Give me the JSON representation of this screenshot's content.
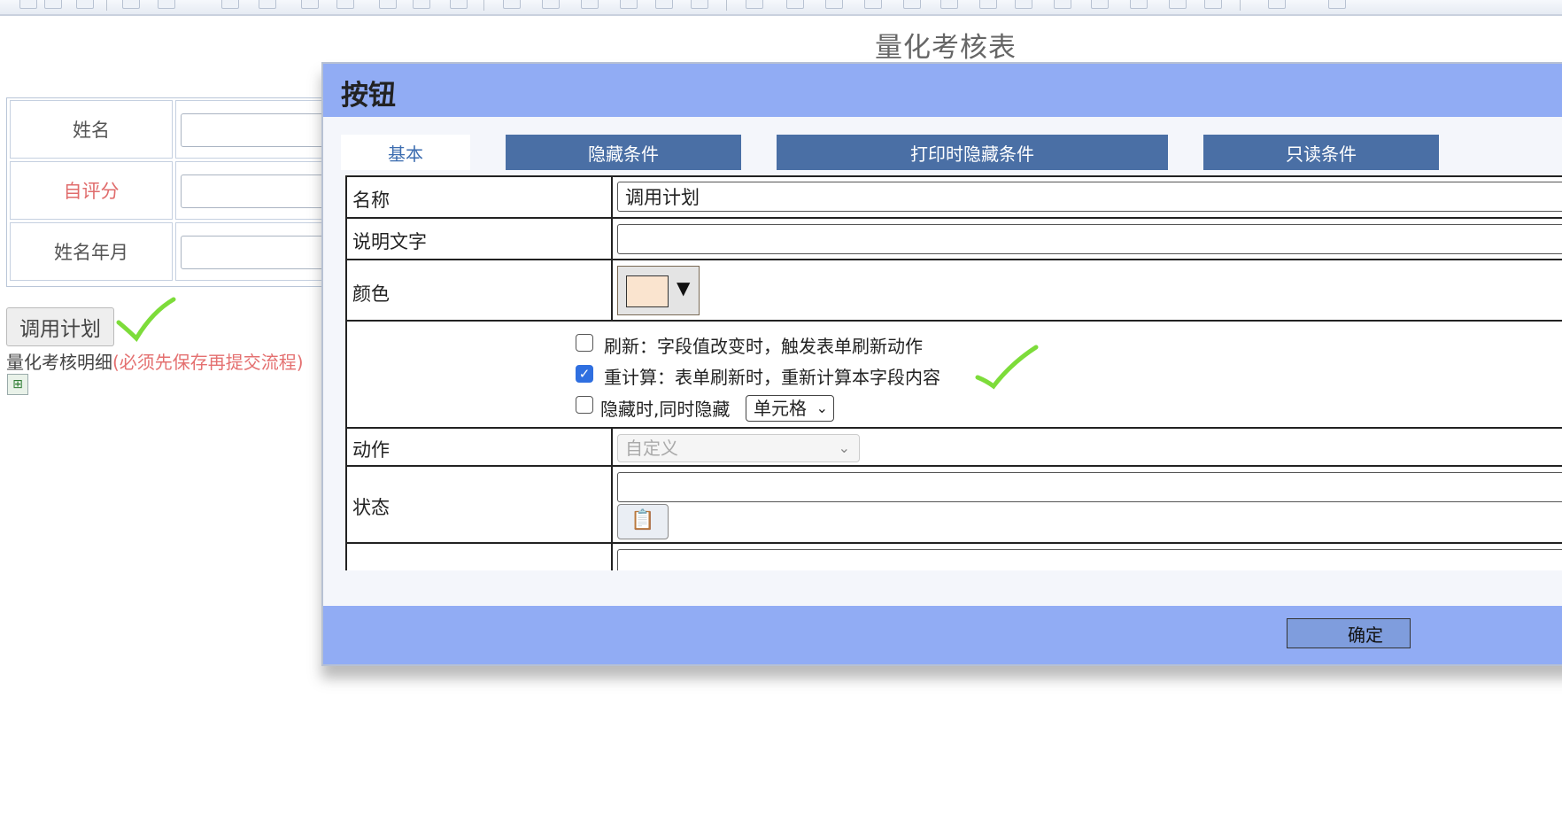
{
  "page": {
    "title": "量化考核表"
  },
  "background_form": {
    "rows": [
      {
        "label": "姓名",
        "color": "#555555"
      },
      {
        "label": "自评分",
        "color": "#e06c6c"
      },
      {
        "label": "姓名年月",
        "color": "#555555"
      }
    ],
    "plan_button_label": "调用计划",
    "detail_label": "量化考核明细",
    "detail_warning": "(必须先保存再提交流程)",
    "sheet_icon": "spreadsheet-icon"
  },
  "dialog": {
    "title": "按钮",
    "tabs": [
      {
        "label": "基本",
        "active": true
      },
      {
        "label": "隐藏条件",
        "active": false
      },
      {
        "label": "打印时隐藏条件",
        "active": false
      },
      {
        "label": "只读条件",
        "active": false
      }
    ],
    "fields": {
      "name_label": "名称",
      "name_value": "调用计划",
      "desc_label": "说明文字",
      "desc_value": "",
      "color_label": "颜色",
      "color_value": "#fae4cf",
      "action_label": "动作",
      "action_value": "自定义",
      "status_label": "状态",
      "status_value": ""
    },
    "options": {
      "refresh": {
        "label": "刷新：字段值改变时，触发表单刷新动作",
        "checked": false
      },
      "recalc": {
        "label": "重计算：表单刷新时，重新计算本字段内容",
        "checked": true
      },
      "hide_with": {
        "label": "隐藏时,同时隐藏",
        "checked": false,
        "select_value": "单元格"
      }
    },
    "ok_label": "确定"
  },
  "colors": {
    "header": "#91acf4",
    "tab_inactive": "#4a6fa5",
    "annotation_check": "#7ddc3a"
  }
}
